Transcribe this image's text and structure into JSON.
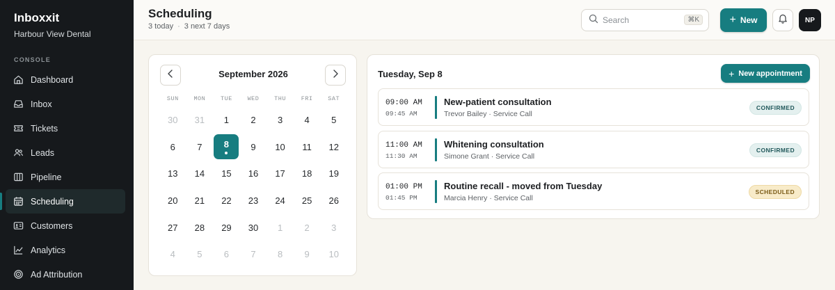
{
  "app": {
    "name": "Inboxxit",
    "org": "Harbour View Dental",
    "section_label": "CONSOLE"
  },
  "sidebar": {
    "items": [
      {
        "label": "Dashboard",
        "icon": "home-icon"
      },
      {
        "label": "Inbox",
        "icon": "inbox-icon"
      },
      {
        "label": "Tickets",
        "icon": "ticket-icon"
      },
      {
        "label": "Leads",
        "icon": "users-icon"
      },
      {
        "label": "Pipeline",
        "icon": "pipeline-icon"
      },
      {
        "label": "Scheduling",
        "icon": "calendar-icon",
        "active": true
      },
      {
        "label": "Customers",
        "icon": "id-card-icon"
      },
      {
        "label": "Analytics",
        "icon": "chart-icon"
      },
      {
        "label": "Ad Attribution",
        "icon": "target-icon"
      }
    ]
  },
  "header": {
    "title": "Scheduling",
    "today_count": "3 today",
    "next_count": "3 next 7 days",
    "search_placeholder": "Search",
    "search_shortcut": "⌘K",
    "new_label": "New",
    "avatar_initials": "NP"
  },
  "calendar": {
    "month_label": "September 2026",
    "weekdays": [
      "SUN",
      "MON",
      "TUE",
      "WED",
      "THU",
      "FRI",
      "SAT"
    ],
    "days": [
      {
        "d": "30",
        "m": true
      },
      {
        "d": "31",
        "m": true
      },
      {
        "d": "1"
      },
      {
        "d": "2"
      },
      {
        "d": "3"
      },
      {
        "d": "4"
      },
      {
        "d": "5"
      },
      {
        "d": "6"
      },
      {
        "d": "7"
      },
      {
        "d": "8",
        "sel": true
      },
      {
        "d": "9"
      },
      {
        "d": "10"
      },
      {
        "d": "11"
      },
      {
        "d": "12"
      },
      {
        "d": "13"
      },
      {
        "d": "14"
      },
      {
        "d": "15"
      },
      {
        "d": "16"
      },
      {
        "d": "17"
      },
      {
        "d": "18"
      },
      {
        "d": "19"
      },
      {
        "d": "20"
      },
      {
        "d": "21"
      },
      {
        "d": "22"
      },
      {
        "d": "23"
      },
      {
        "d": "24"
      },
      {
        "d": "25"
      },
      {
        "d": "26"
      },
      {
        "d": "27"
      },
      {
        "d": "28"
      },
      {
        "d": "29"
      },
      {
        "d": "30"
      },
      {
        "d": "1",
        "m": true
      },
      {
        "d": "2",
        "m": true
      },
      {
        "d": "3",
        "m": true
      },
      {
        "d": "4",
        "m": true
      },
      {
        "d": "5",
        "m": true
      },
      {
        "d": "6",
        "m": true
      },
      {
        "d": "7",
        "m": true
      },
      {
        "d": "8",
        "m": true
      },
      {
        "d": "9",
        "m": true
      },
      {
        "d": "10",
        "m": true
      }
    ]
  },
  "appointments": {
    "day_label": "Tuesday, Sep 8",
    "new_label": "New appointment",
    "items": [
      {
        "start": "09:00 AM",
        "end": "09:45 AM",
        "title": "New-patient consultation",
        "meta": "Trevor Bailey · Service Call",
        "status": "CONFIRMED",
        "status_kind": "confirmed"
      },
      {
        "start": "11:00 AM",
        "end": "11:30 AM",
        "title": "Whitening consultation",
        "meta": "Simone Grant · Service Call",
        "status": "CONFIRMED",
        "status_kind": "confirmed"
      },
      {
        "start": "01:00 PM",
        "end": "01:45 PM",
        "title": "Routine recall - moved from Tuesday",
        "meta": "Marcia Henry · Service Call",
        "status": "SCHEDULED",
        "status_kind": "scheduled"
      }
    ]
  },
  "colors": {
    "accent": "#177d80",
    "sidebar_bg": "#16191c",
    "page_bg": "#f7f5ef"
  }
}
